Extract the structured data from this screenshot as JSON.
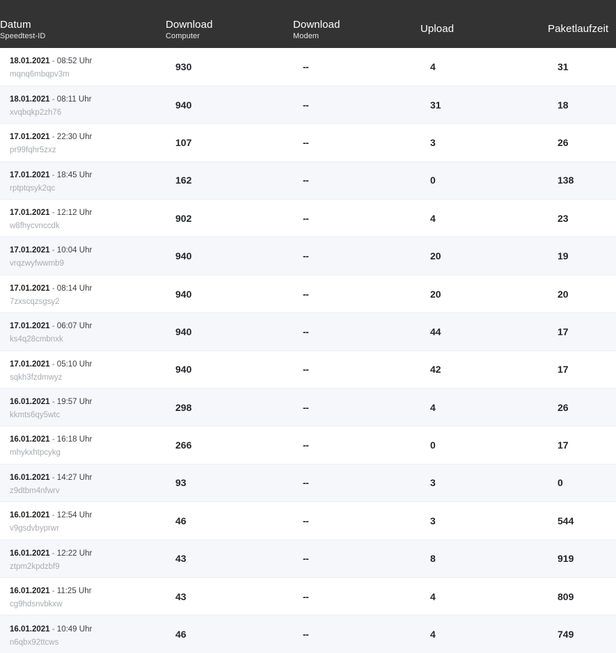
{
  "table": {
    "columns": [
      {
        "key": "datum",
        "main": "Datum",
        "sub": "Speedtest-ID"
      },
      {
        "key": "dlcomp",
        "main": "Download",
        "sub": "Computer"
      },
      {
        "key": "dlmodem",
        "main": "Download",
        "sub": "Modem"
      },
      {
        "key": "upload",
        "main": "Upload",
        "sub": ""
      },
      {
        "key": "ping",
        "main": "Paketlaufzeit",
        "sub": ""
      }
    ],
    "time_suffix": "Uhr",
    "separator": "-",
    "rows": [
      {
        "date": "18.01.2021",
        "time": "08:52",
        "id": "mqnq6mbqpv3m",
        "download_computer": "930",
        "download_modem": "--",
        "upload": "4",
        "paketlaufzeit": "31"
      },
      {
        "date": "18.01.2021",
        "time": "08:11",
        "id": "xvqbqkp2zh76",
        "download_computer": "940",
        "download_modem": "--",
        "upload": "31",
        "paketlaufzeit": "18"
      },
      {
        "date": "17.01.2021",
        "time": "22:30",
        "id": "pr99fqhr5zxz",
        "download_computer": "107",
        "download_modem": "--",
        "upload": "3",
        "paketlaufzeit": "26"
      },
      {
        "date": "17.01.2021",
        "time": "18:45",
        "id": "rptptqsyk2qc",
        "download_computer": "162",
        "download_modem": "--",
        "upload": "0",
        "paketlaufzeit": "138"
      },
      {
        "date": "17.01.2021",
        "time": "12:12",
        "id": "w8fhycvnccdk",
        "download_computer": "902",
        "download_modem": "--",
        "upload": "4",
        "paketlaufzeit": "23"
      },
      {
        "date": "17.01.2021",
        "time": "10:04",
        "id": "vrqzwyfwwmb9",
        "download_computer": "940",
        "download_modem": "--",
        "upload": "20",
        "paketlaufzeit": "19"
      },
      {
        "date": "17.01.2021",
        "time": "08:14",
        "id": "7zxscqzsgsy2",
        "download_computer": "940",
        "download_modem": "--",
        "upload": "20",
        "paketlaufzeit": "20"
      },
      {
        "date": "17.01.2021",
        "time": "06:07",
        "id": "ks4q28cmbnxk",
        "download_computer": "940",
        "download_modem": "--",
        "upload": "44",
        "paketlaufzeit": "17"
      },
      {
        "date": "17.01.2021",
        "time": "05:10",
        "id": "sqkh3fzdmwyz",
        "download_computer": "940",
        "download_modem": "--",
        "upload": "42",
        "paketlaufzeit": "17"
      },
      {
        "date": "16.01.2021",
        "time": "19:57",
        "id": "kkmts6qy5wtc",
        "download_computer": "298",
        "download_modem": "--",
        "upload": "4",
        "paketlaufzeit": "26"
      },
      {
        "date": "16.01.2021",
        "time": "16:18",
        "id": "mhykxhtpcykg",
        "download_computer": "266",
        "download_modem": "--",
        "upload": "0",
        "paketlaufzeit": "17"
      },
      {
        "date": "16.01.2021",
        "time": "14:27",
        "id": "z9dtbm4nfwrv",
        "download_computer": "93",
        "download_modem": "--",
        "upload": "3",
        "paketlaufzeit": "0"
      },
      {
        "date": "16.01.2021",
        "time": "12:54",
        "id": "v9gsdvbyprwr",
        "download_computer": "46",
        "download_modem": "--",
        "upload": "3",
        "paketlaufzeit": "544"
      },
      {
        "date": "16.01.2021",
        "time": "12:22",
        "id": "ztpm2kpdzbf9",
        "download_computer": "43",
        "download_modem": "--",
        "upload": "8",
        "paketlaufzeit": "919"
      },
      {
        "date": "16.01.2021",
        "time": "11:25",
        "id": "cg9hdsnvbkxw",
        "download_computer": "43",
        "download_modem": "--",
        "upload": "4",
        "paketlaufzeit": "809"
      },
      {
        "date": "16.01.2021",
        "time": "10:49",
        "id": "n6qbx92ttcws",
        "download_computer": "46",
        "download_modem": "--",
        "upload": "4",
        "paketlaufzeit": "749"
      }
    ]
  },
  "colors": {
    "header_background": "#333333",
    "header_text": "#ffffff",
    "row_background": "#ffffff",
    "row_background_alt": "#f6f7fb",
    "value_text": "#25262a",
    "id_text": "#a8abb3"
  }
}
